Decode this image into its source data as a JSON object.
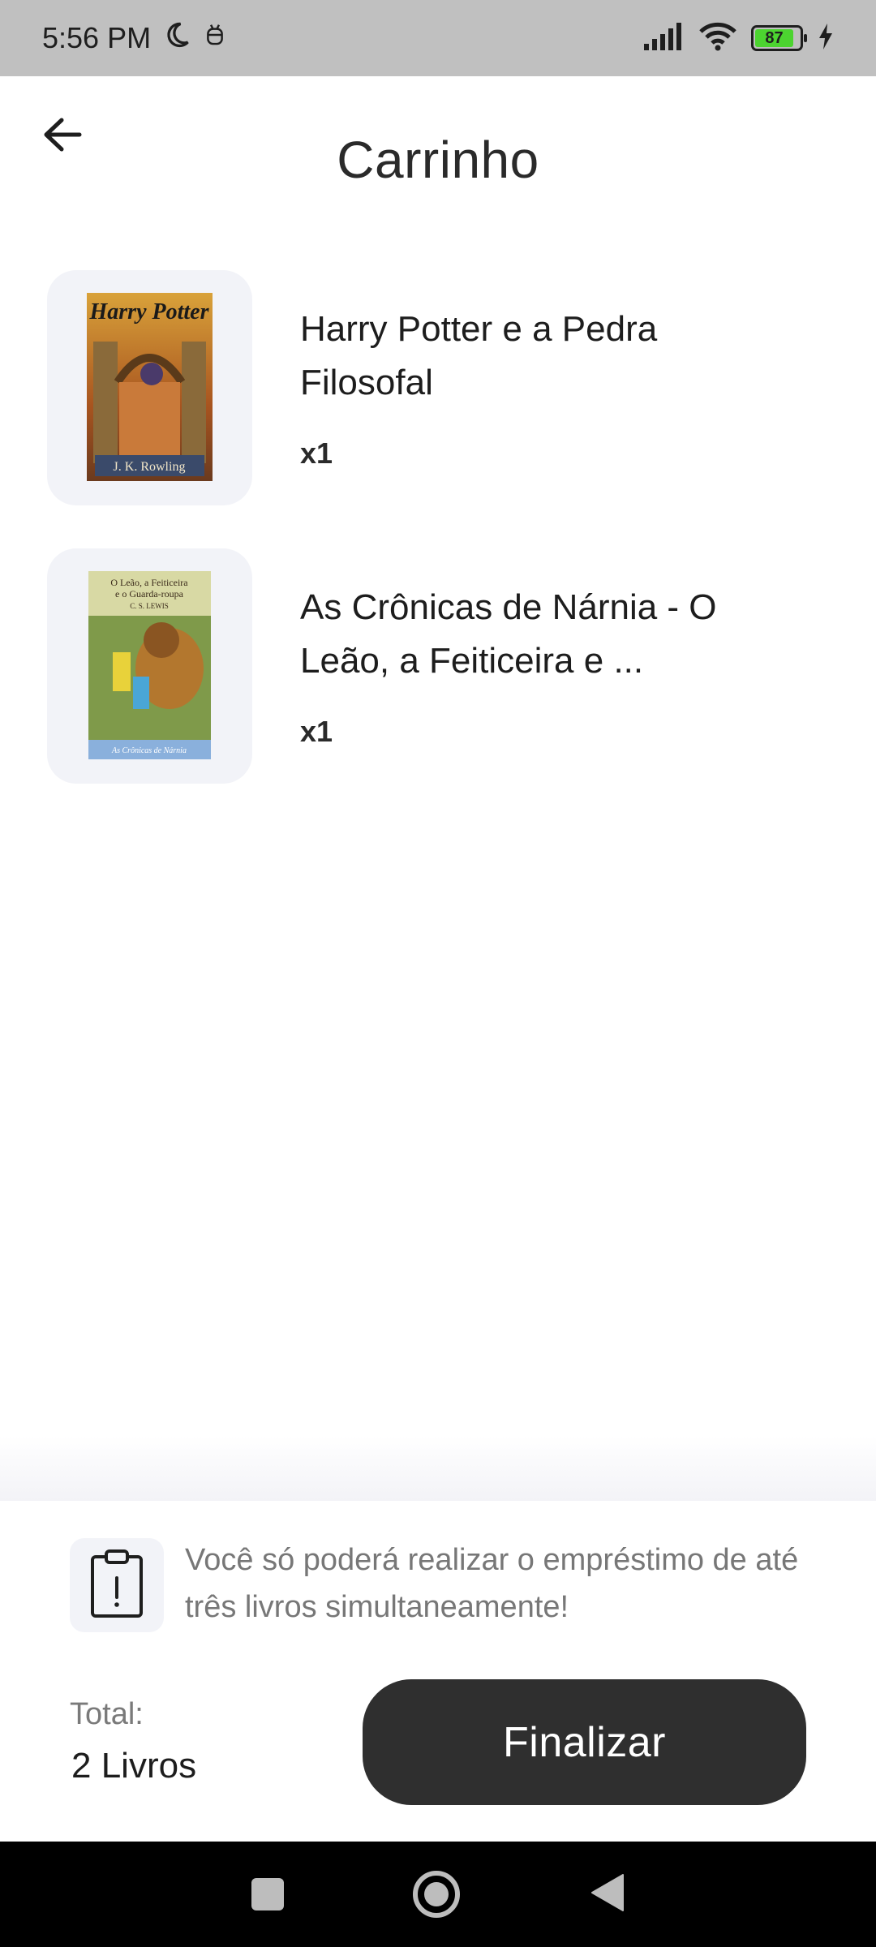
{
  "status_bar": {
    "time": "5:56 PM",
    "battery_level": "87",
    "icons": [
      "moon-icon",
      "android-debug-icon",
      "signal-icon",
      "wifi-icon",
      "battery-icon",
      "charging-icon"
    ]
  },
  "header": {
    "title": "Carrinho",
    "back_icon": "arrow-left-icon"
  },
  "cart": {
    "items": [
      {
        "title": "Harry Potter e a Pedra Filosofal",
        "qty": "x1",
        "cover_title": "Harry Potter",
        "cover_author": "J. K. Rowling"
      },
      {
        "title": "As Crônicas de Nárnia - O Leão, a Feiticeira e ...",
        "qty": "x1",
        "cover_title": "O Leão, a Feiticeira e o Guarda-roupa",
        "cover_author": "C. S. LEWIS",
        "cover_series": "As Crônicas de Nárnia"
      }
    ]
  },
  "notice": {
    "icon": "clipboard-alert-icon",
    "text": "Você só poderá realizar o empréstimo de até três livros simultaneamente!"
  },
  "summary": {
    "total_label": "Total:",
    "total_value": "2 Livros",
    "finalize_label": "Finalizar"
  },
  "colors": {
    "accent_dark": "#2f2f2f",
    "card_bg": "#f2f3f8",
    "status_bar_bg": "#c0c0c0",
    "battery_green": "#4cd430"
  }
}
